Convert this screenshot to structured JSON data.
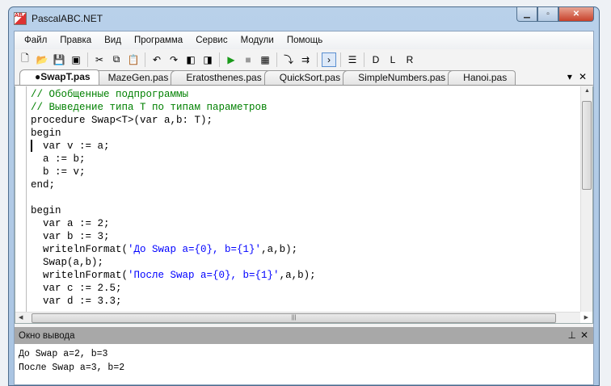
{
  "window": {
    "title": "PascalABC.NET",
    "icon": "pascalabc-app-icon"
  },
  "menu": [
    "Файл",
    "Правка",
    "Вид",
    "Программа",
    "Сервис",
    "Модули",
    "Помощь"
  ],
  "toolbar": [
    {
      "icon": "new-file-icon",
      "glyph": "🗋"
    },
    {
      "icon": "open-folder-icon",
      "glyph": "📂"
    },
    {
      "icon": "save-icon",
      "glyph": "💾"
    },
    {
      "icon": "save-all-icon",
      "glyph": "▣"
    },
    "sep",
    {
      "icon": "cut-icon",
      "glyph": "✂"
    },
    {
      "icon": "copy-icon",
      "glyph": "⧉"
    },
    {
      "icon": "paste-icon",
      "glyph": "📋"
    },
    "sep",
    {
      "icon": "undo-icon",
      "glyph": "↶"
    },
    {
      "icon": "redo-icon",
      "glyph": "↷"
    },
    {
      "icon": "navigate-back-icon",
      "glyph": "◧"
    },
    {
      "icon": "navigate-forward-icon",
      "glyph": "◨"
    },
    "sep",
    {
      "icon": "run-icon",
      "glyph": "▶",
      "color": "#1a9a1a"
    },
    {
      "icon": "stop-icon",
      "glyph": "■",
      "color": "#999"
    },
    {
      "icon": "compile-icon",
      "glyph": "▦"
    },
    "sep",
    {
      "icon": "step-into-icon",
      "glyph": "⤵"
    },
    {
      "icon": "step-over-icon",
      "glyph": "⇉"
    },
    "sep",
    {
      "icon": "output-window-icon",
      "glyph": "›",
      "active": true
    },
    "sep",
    {
      "icon": "format-code-icon",
      "glyph": "☰"
    },
    "sep",
    {
      "icon": "designer-d-icon",
      "glyph": "D"
    },
    {
      "icon": "designer-l-icon",
      "glyph": "L"
    },
    {
      "icon": "designer-r-icon",
      "glyph": "R"
    }
  ],
  "tabs": [
    {
      "label": "●SwapT.pas",
      "active": true
    },
    {
      "label": "MazeGen.pas"
    },
    {
      "label": "Eratosthenes.pas"
    },
    {
      "label": "QuickSort.pas"
    },
    {
      "label": "SimpleNumbers.pas"
    },
    {
      "label": "Hanoi.pas"
    }
  ],
  "code": [
    [
      [
        "cm",
        "// Обобщенные подпрограммы"
      ]
    ],
    [
      [
        "cm",
        "// Выведение типа T по типам параметров"
      ]
    ],
    [
      [
        "kw",
        "procedure"
      ],
      [
        "tx",
        " Swap<T>("
      ],
      [
        "kw",
        "var"
      ],
      [
        "tx",
        " a,b: T);"
      ]
    ],
    [
      [
        "kw",
        "begin"
      ]
    ],
    [
      [
        "tx",
        "  "
      ],
      [
        "kw",
        "var"
      ],
      [
        "tx",
        " v := a;"
      ]
    ],
    [
      [
        "tx",
        "  a := b;"
      ]
    ],
    [
      [
        "tx",
        "  b := v;"
      ]
    ],
    [
      [
        "kw",
        "end"
      ],
      [
        "tx",
        ";"
      ]
    ],
    [
      [
        "tx",
        ""
      ]
    ],
    [
      [
        "kw",
        "begin"
      ]
    ],
    [
      [
        "tx",
        "  "
      ],
      [
        "kw",
        "var"
      ],
      [
        "tx",
        " a := 2;"
      ]
    ],
    [
      [
        "tx",
        "  "
      ],
      [
        "kw",
        "var"
      ],
      [
        "tx",
        " b := 3;"
      ]
    ],
    [
      [
        "tx",
        "  writelnFormat("
      ],
      [
        "st",
        "'До Swap a={0}, b={1}'"
      ],
      [
        "tx",
        ",a,b);"
      ]
    ],
    [
      [
        "tx",
        "  Swap(a,b);"
      ]
    ],
    [
      [
        "tx",
        "  writelnFormat("
      ],
      [
        "st",
        "'После Swap a={0}, b={1}'"
      ],
      [
        "tx",
        ",a,b);"
      ]
    ],
    [
      [
        "tx",
        "  "
      ],
      [
        "kw",
        "var"
      ],
      [
        "tx",
        " c := 2.5;"
      ]
    ],
    [
      [
        "tx",
        "  "
      ],
      [
        "kw",
        "var"
      ],
      [
        "tx",
        " d := 3.3;"
      ]
    ]
  ],
  "output": {
    "title": "Окно вывода",
    "lines": [
      "До Swap a=2, b=3",
      "После Swap a=3, b=2"
    ]
  }
}
